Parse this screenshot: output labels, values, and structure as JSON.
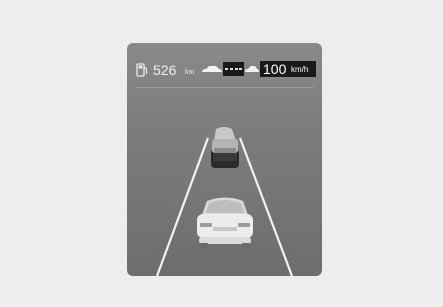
{
  "cluster": {
    "range_value": "526",
    "range_unit": "km",
    "set_speed_value": "100",
    "set_speed_unit": "km/h"
  },
  "icons": {
    "fuel": "fuel-pump-icon",
    "lead_vehicle": "lead-vehicle-icon",
    "distance": "following-distance-bars-icon",
    "own_vehicle": "own-vehicle-icon"
  },
  "colors": {
    "background": "#efefef",
    "display": "#7b7b7b",
    "speed_box": "#1a1a1a"
  }
}
